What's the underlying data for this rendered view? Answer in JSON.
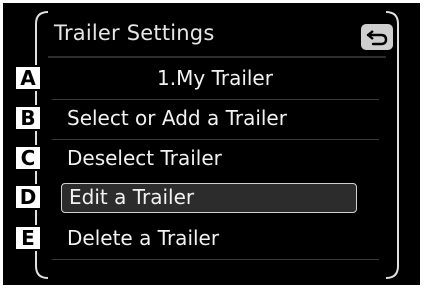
{
  "screen": {
    "title": "Trailer Settings",
    "back_icon": "back-arrow-icon"
  },
  "menu": {
    "items": [
      {
        "marker": "A",
        "label": "1.My Trailer"
      },
      {
        "marker": "B",
        "label": "Select or Add a Trailer"
      },
      {
        "marker": "C",
        "label": "Deselect Trailer"
      },
      {
        "marker": "D",
        "label": "Edit a Trailer",
        "selected": true
      },
      {
        "marker": "E",
        "label": "Delete a Trailer"
      }
    ]
  },
  "colors": {
    "background": "#000000",
    "text": "#f2f2f2",
    "highlight_border": "#d0d0d0",
    "back_button": "#cfcfcf"
  }
}
